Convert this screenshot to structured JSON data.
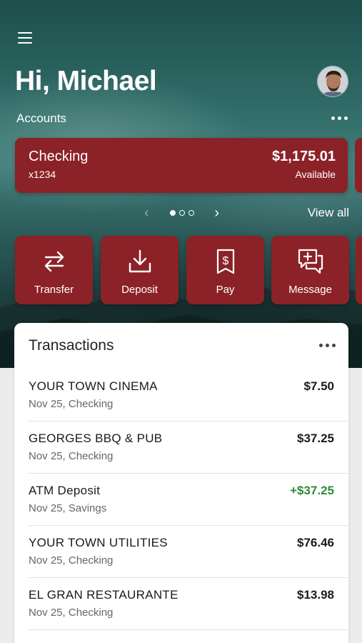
{
  "header": {
    "greeting": "Hi, Michael"
  },
  "accounts": {
    "label": "Accounts",
    "view_all": "View all",
    "pager": {
      "total": 3,
      "active": 0
    },
    "cards": [
      {
        "name": "Checking",
        "number": "x1234",
        "balance": "$1,175.01",
        "balance_label": "Available"
      }
    ]
  },
  "actions": [
    {
      "label": "Transfer",
      "icon": "transfer-icon"
    },
    {
      "label": "Deposit",
      "icon": "deposit-icon"
    },
    {
      "label": "Pay",
      "icon": "pay-icon"
    },
    {
      "label": "Message",
      "icon": "message-icon"
    }
  ],
  "transactions": {
    "title": "Transactions",
    "items": [
      {
        "name": "YOUR TOWN CINEMA",
        "detail": "Nov 25, Checking",
        "amount": "$7.50",
        "credit": false
      },
      {
        "name": "GEORGES BBQ & PUB",
        "detail": "Nov 25, Checking",
        "amount": "$37.25",
        "credit": false
      },
      {
        "name": "ATM Deposit",
        "detail": "Nov 25, Savings",
        "amount": "+$37.25",
        "credit": true
      },
      {
        "name": "YOUR TOWN UTILITIES",
        "detail": "Nov 25, Checking",
        "amount": "$76.46",
        "credit": false
      },
      {
        "name": "EL GRAN RESTAURANTE",
        "detail": "Nov 25, Checking",
        "amount": "$13.98",
        "credit": false
      }
    ]
  },
  "colors": {
    "brand": "#8b2228",
    "credit": "#2e8b3a"
  }
}
